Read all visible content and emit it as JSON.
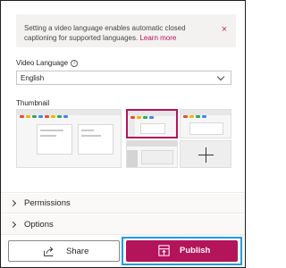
{
  "info_bar": {
    "message": "Setting a video language enables automatic closed captioning for supported languages.",
    "link_text": "Learn more",
    "close_glyph": "×"
  },
  "video_language": {
    "label": "Video Language",
    "info_glyph": "i",
    "selected": "English"
  },
  "thumbnail": {
    "label": "Thumbnail",
    "add_glyph": "+"
  },
  "sections": {
    "permissions": "Permissions",
    "options": "Options"
  },
  "footer": {
    "share_label": "Share",
    "publish_label": "Publish"
  },
  "colors": {
    "accent": "#b4145a",
    "focus_outline": "#1f9ce0",
    "info_bar_bg": "#f3f2f1"
  },
  "icons": {
    "close": "close-icon",
    "info": "info-icon",
    "dropdown": "chevron-down-icon",
    "expand": "chevron-right-icon",
    "share": "share-icon",
    "publish": "publish-icon",
    "add": "plus-icon"
  }
}
